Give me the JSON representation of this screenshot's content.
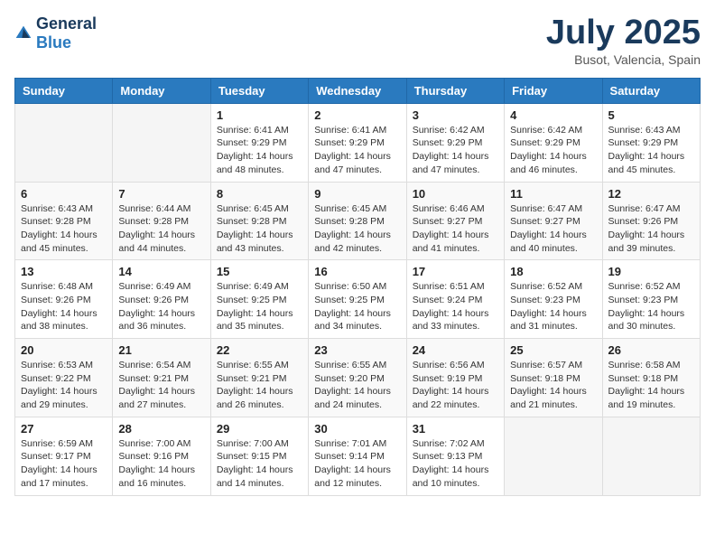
{
  "logo": {
    "general": "General",
    "blue": "Blue"
  },
  "header": {
    "title": "July 2025",
    "subtitle": "Busot, Valencia, Spain"
  },
  "weekdays": [
    "Sunday",
    "Monday",
    "Tuesday",
    "Wednesday",
    "Thursday",
    "Friday",
    "Saturday"
  ],
  "weeks": [
    [
      {
        "day": "",
        "sunrise": "",
        "sunset": "",
        "daylight": ""
      },
      {
        "day": "",
        "sunrise": "",
        "sunset": "",
        "daylight": ""
      },
      {
        "day": "1",
        "sunrise": "Sunrise: 6:41 AM",
        "sunset": "Sunset: 9:29 PM",
        "daylight": "Daylight: 14 hours and 48 minutes."
      },
      {
        "day": "2",
        "sunrise": "Sunrise: 6:41 AM",
        "sunset": "Sunset: 9:29 PM",
        "daylight": "Daylight: 14 hours and 47 minutes."
      },
      {
        "day": "3",
        "sunrise": "Sunrise: 6:42 AM",
        "sunset": "Sunset: 9:29 PM",
        "daylight": "Daylight: 14 hours and 47 minutes."
      },
      {
        "day": "4",
        "sunrise": "Sunrise: 6:42 AM",
        "sunset": "Sunset: 9:29 PM",
        "daylight": "Daylight: 14 hours and 46 minutes."
      },
      {
        "day": "5",
        "sunrise": "Sunrise: 6:43 AM",
        "sunset": "Sunset: 9:29 PM",
        "daylight": "Daylight: 14 hours and 45 minutes."
      }
    ],
    [
      {
        "day": "6",
        "sunrise": "Sunrise: 6:43 AM",
        "sunset": "Sunset: 9:28 PM",
        "daylight": "Daylight: 14 hours and 45 minutes."
      },
      {
        "day": "7",
        "sunrise": "Sunrise: 6:44 AM",
        "sunset": "Sunset: 9:28 PM",
        "daylight": "Daylight: 14 hours and 44 minutes."
      },
      {
        "day": "8",
        "sunrise": "Sunrise: 6:45 AM",
        "sunset": "Sunset: 9:28 PM",
        "daylight": "Daylight: 14 hours and 43 minutes."
      },
      {
        "day": "9",
        "sunrise": "Sunrise: 6:45 AM",
        "sunset": "Sunset: 9:28 PM",
        "daylight": "Daylight: 14 hours and 42 minutes."
      },
      {
        "day": "10",
        "sunrise": "Sunrise: 6:46 AM",
        "sunset": "Sunset: 9:27 PM",
        "daylight": "Daylight: 14 hours and 41 minutes."
      },
      {
        "day": "11",
        "sunrise": "Sunrise: 6:47 AM",
        "sunset": "Sunset: 9:27 PM",
        "daylight": "Daylight: 14 hours and 40 minutes."
      },
      {
        "day": "12",
        "sunrise": "Sunrise: 6:47 AM",
        "sunset": "Sunset: 9:26 PM",
        "daylight": "Daylight: 14 hours and 39 minutes."
      }
    ],
    [
      {
        "day": "13",
        "sunrise": "Sunrise: 6:48 AM",
        "sunset": "Sunset: 9:26 PM",
        "daylight": "Daylight: 14 hours and 38 minutes."
      },
      {
        "day": "14",
        "sunrise": "Sunrise: 6:49 AM",
        "sunset": "Sunset: 9:26 PM",
        "daylight": "Daylight: 14 hours and 36 minutes."
      },
      {
        "day": "15",
        "sunrise": "Sunrise: 6:49 AM",
        "sunset": "Sunset: 9:25 PM",
        "daylight": "Daylight: 14 hours and 35 minutes."
      },
      {
        "day": "16",
        "sunrise": "Sunrise: 6:50 AM",
        "sunset": "Sunset: 9:25 PM",
        "daylight": "Daylight: 14 hours and 34 minutes."
      },
      {
        "day": "17",
        "sunrise": "Sunrise: 6:51 AM",
        "sunset": "Sunset: 9:24 PM",
        "daylight": "Daylight: 14 hours and 33 minutes."
      },
      {
        "day": "18",
        "sunrise": "Sunrise: 6:52 AM",
        "sunset": "Sunset: 9:23 PM",
        "daylight": "Daylight: 14 hours and 31 minutes."
      },
      {
        "day": "19",
        "sunrise": "Sunrise: 6:52 AM",
        "sunset": "Sunset: 9:23 PM",
        "daylight": "Daylight: 14 hours and 30 minutes."
      }
    ],
    [
      {
        "day": "20",
        "sunrise": "Sunrise: 6:53 AM",
        "sunset": "Sunset: 9:22 PM",
        "daylight": "Daylight: 14 hours and 29 minutes."
      },
      {
        "day": "21",
        "sunrise": "Sunrise: 6:54 AM",
        "sunset": "Sunset: 9:21 PM",
        "daylight": "Daylight: 14 hours and 27 minutes."
      },
      {
        "day": "22",
        "sunrise": "Sunrise: 6:55 AM",
        "sunset": "Sunset: 9:21 PM",
        "daylight": "Daylight: 14 hours and 26 minutes."
      },
      {
        "day": "23",
        "sunrise": "Sunrise: 6:55 AM",
        "sunset": "Sunset: 9:20 PM",
        "daylight": "Daylight: 14 hours and 24 minutes."
      },
      {
        "day": "24",
        "sunrise": "Sunrise: 6:56 AM",
        "sunset": "Sunset: 9:19 PM",
        "daylight": "Daylight: 14 hours and 22 minutes."
      },
      {
        "day": "25",
        "sunrise": "Sunrise: 6:57 AM",
        "sunset": "Sunset: 9:18 PM",
        "daylight": "Daylight: 14 hours and 21 minutes."
      },
      {
        "day": "26",
        "sunrise": "Sunrise: 6:58 AM",
        "sunset": "Sunset: 9:18 PM",
        "daylight": "Daylight: 14 hours and 19 minutes."
      }
    ],
    [
      {
        "day": "27",
        "sunrise": "Sunrise: 6:59 AM",
        "sunset": "Sunset: 9:17 PM",
        "daylight": "Daylight: 14 hours and 17 minutes."
      },
      {
        "day": "28",
        "sunrise": "Sunrise: 7:00 AM",
        "sunset": "Sunset: 9:16 PM",
        "daylight": "Daylight: 14 hours and 16 minutes."
      },
      {
        "day": "29",
        "sunrise": "Sunrise: 7:00 AM",
        "sunset": "Sunset: 9:15 PM",
        "daylight": "Daylight: 14 hours and 14 minutes."
      },
      {
        "day": "30",
        "sunrise": "Sunrise: 7:01 AM",
        "sunset": "Sunset: 9:14 PM",
        "daylight": "Daylight: 14 hours and 12 minutes."
      },
      {
        "day": "31",
        "sunrise": "Sunrise: 7:02 AM",
        "sunset": "Sunset: 9:13 PM",
        "daylight": "Daylight: 14 hours and 10 minutes."
      },
      {
        "day": "",
        "sunrise": "",
        "sunset": "",
        "daylight": ""
      },
      {
        "day": "",
        "sunrise": "",
        "sunset": "",
        "daylight": ""
      }
    ]
  ]
}
